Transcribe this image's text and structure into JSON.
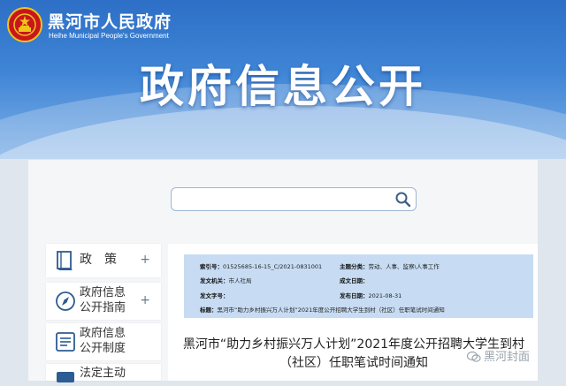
{
  "header": {
    "site_name": "黑河市人民政府",
    "site_name_en": "Heihe Municipal People's Government",
    "banner_title": "政府信息公开"
  },
  "search": {
    "placeholder": "",
    "value": "",
    "icon": "search-icon"
  },
  "sidebar": {
    "items": [
      {
        "label": "政　策",
        "icon": "book-icon",
        "expand": "+"
      },
      {
        "label": "政府信息\n公开指南",
        "icon": "compass-icon",
        "expand": "+"
      },
      {
        "label": "政府信息\n公开制度",
        "icon": "list-icon",
        "expand": ""
      },
      {
        "label": "法定主动",
        "icon": "folder-icon",
        "expand": ""
      }
    ]
  },
  "metadata": {
    "index_key": "索引号：",
    "index_val": "01525685-16-15_C/2021-0831001",
    "category_key": "主题分类：",
    "category_val": "劳动、人事、监察\\人事工作",
    "issuer_key": "发文机关：",
    "issuer_val": "市人社局",
    "date_written_key": "成文日期：",
    "date_written_val": "",
    "doc_no_key": "发文字号：",
    "doc_no_val": "",
    "publish_date_key": "发布日期：",
    "publish_date_val": "2021-08-31",
    "title_key": "标题：",
    "title_val": "黑河市“助力乡村振兴万人计划”2021年度公开招聘大学生到村（社区）任职笔试时间通知"
  },
  "article": {
    "title_line1": "黑河市“助力乡村振兴万人计划”2021年度公开招聘大学生到村",
    "title_line2": "（社区）任职笔试时间通知"
  },
  "watermark": {
    "text": "黑河封面",
    "icon": "wechat-icon"
  },
  "colors": {
    "banner_top": "#2d6fc6",
    "banner_bottom": "#7fb0e6",
    "meta_bg": "#c7dcf3",
    "emblem_red": "#c8161d",
    "emblem_gold": "#f0c419"
  }
}
